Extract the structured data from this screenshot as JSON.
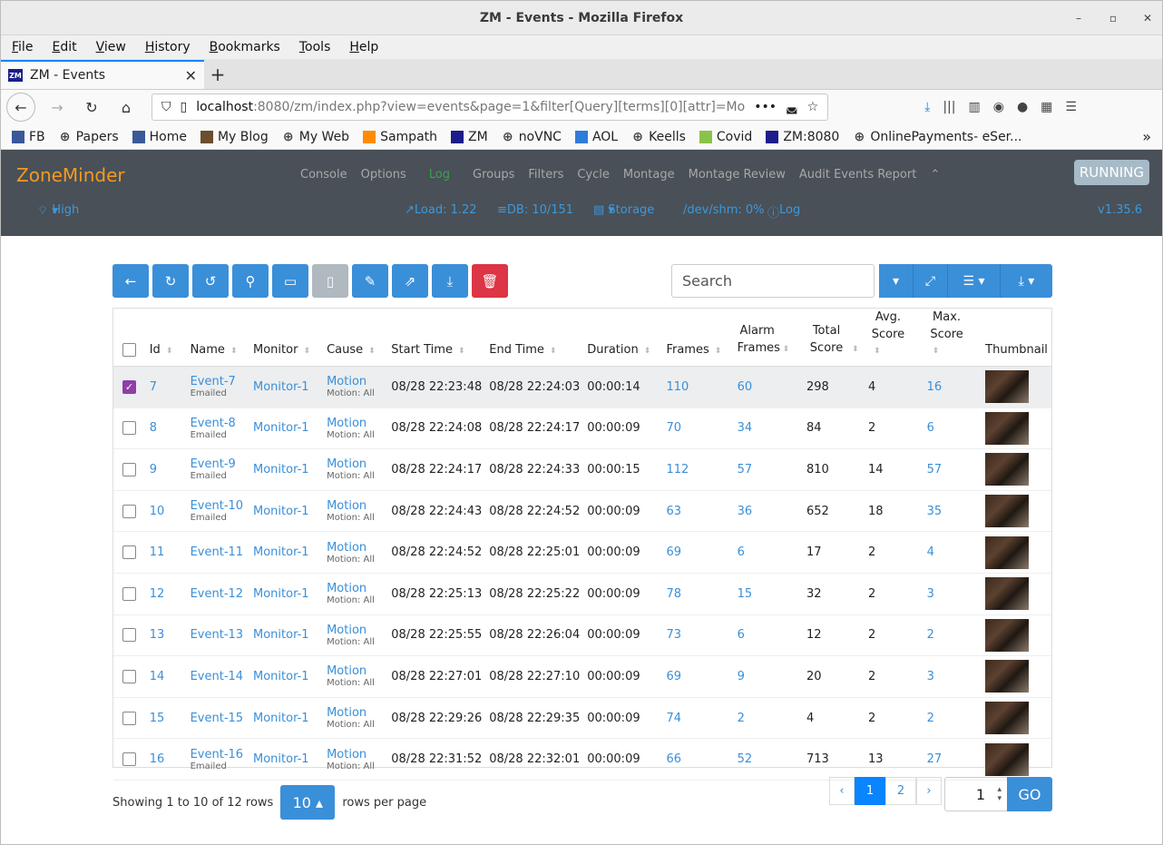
{
  "window": {
    "title": "ZM - Events - Mozilla Firefox"
  },
  "menu": [
    "File",
    "Edit",
    "View",
    "History",
    "Bookmarks",
    "Tools",
    "Help"
  ],
  "tab": {
    "title": "ZM - Events"
  },
  "url": {
    "host": "localhost",
    "rest": ":8080/zm/index.php?view=events&page=1&filter[Query][terms][0][attr]=Mo"
  },
  "bookmarks": [
    "FB",
    "Papers",
    "Home",
    "My Blog",
    "My Web",
    "Sampath",
    "ZM",
    "noVNC",
    "AOL",
    "Keells",
    "Covid",
    "ZM:8080",
    "OnlinePayments- eSer..."
  ],
  "zm": {
    "brand": "ZoneMinder",
    "nav": [
      "Console",
      "Options",
      "Log",
      "Groups",
      "Filters",
      "Cycle",
      "Montage",
      "Montage Review",
      "Audit Events Report"
    ],
    "running": "RUNNING",
    "bandwidth": "High",
    "load": "Load: 1.22",
    "db": "DB: 10/151",
    "storage": "Storage",
    "shm": "/dev/shm: 0%",
    "log": "Log",
    "version": "v1.35.6"
  },
  "search": {
    "placeholder": "Search"
  },
  "columns": [
    "Id",
    "Name",
    "Monitor",
    "Cause",
    "Start Time",
    "End Time",
    "Duration",
    "Frames",
    "Alarm Frames",
    "Total Score",
    "Avg. Score",
    "Max. Score",
    "Thumbnail"
  ],
  "rows": [
    {
      "id": "7",
      "name": "Event-7",
      "note": "Emailed",
      "monitor": "Monitor-1",
      "cause": "Motion",
      "causeSub": "Motion: All",
      "start": "08/28 22:23:48",
      "end": "08/28 22:24:03",
      "dur": "00:00:14",
      "frames": "110",
      "alarm": "60",
      "total": "298",
      "avg": "4",
      "max": "16",
      "checked": true
    },
    {
      "id": "8",
      "name": "Event-8",
      "note": "Emailed",
      "monitor": "Monitor-1",
      "cause": "Motion",
      "causeSub": "Motion: All",
      "start": "08/28 22:24:08",
      "end": "08/28 22:24:17",
      "dur": "00:00:09",
      "frames": "70",
      "alarm": "34",
      "total": "84",
      "avg": "2",
      "max": "6",
      "checked": false
    },
    {
      "id": "9",
      "name": "Event-9",
      "note": "Emailed",
      "monitor": "Monitor-1",
      "cause": "Motion",
      "causeSub": "Motion: All",
      "start": "08/28 22:24:17",
      "end": "08/28 22:24:33",
      "dur": "00:00:15",
      "frames": "112",
      "alarm": "57",
      "total": "810",
      "avg": "14",
      "max": "57",
      "checked": false
    },
    {
      "id": "10",
      "name": "Event-10",
      "note": "Emailed",
      "monitor": "Monitor-1",
      "cause": "Motion",
      "causeSub": "Motion: All",
      "start": "08/28 22:24:43",
      "end": "08/28 22:24:52",
      "dur": "00:00:09",
      "frames": "63",
      "alarm": "36",
      "total": "652",
      "avg": "18",
      "max": "35",
      "checked": false
    },
    {
      "id": "11",
      "name": "Event-11",
      "note": "",
      "monitor": "Monitor-1",
      "cause": "Motion",
      "causeSub": "Motion: All",
      "start": "08/28 22:24:52",
      "end": "08/28 22:25:01",
      "dur": "00:00:09",
      "frames": "69",
      "alarm": "6",
      "total": "17",
      "avg": "2",
      "max": "4",
      "checked": false
    },
    {
      "id": "12",
      "name": "Event-12",
      "note": "",
      "monitor": "Monitor-1",
      "cause": "Motion",
      "causeSub": "Motion: All",
      "start": "08/28 22:25:13",
      "end": "08/28 22:25:22",
      "dur": "00:00:09",
      "frames": "78",
      "alarm": "15",
      "total": "32",
      "avg": "2",
      "max": "3",
      "checked": false
    },
    {
      "id": "13",
      "name": "Event-13",
      "note": "",
      "monitor": "Monitor-1",
      "cause": "Motion",
      "causeSub": "Motion: All",
      "start": "08/28 22:25:55",
      "end": "08/28 22:26:04",
      "dur": "00:00:09",
      "frames": "73",
      "alarm": "6",
      "total": "12",
      "avg": "2",
      "max": "2",
      "checked": false
    },
    {
      "id": "14",
      "name": "Event-14",
      "note": "",
      "monitor": "Monitor-1",
      "cause": "Motion",
      "causeSub": "Motion: All",
      "start": "08/28 22:27:01",
      "end": "08/28 22:27:10",
      "dur": "00:00:09",
      "frames": "69",
      "alarm": "9",
      "total": "20",
      "avg": "2",
      "max": "3",
      "checked": false
    },
    {
      "id": "15",
      "name": "Event-15",
      "note": "",
      "monitor": "Monitor-1",
      "cause": "Motion",
      "causeSub": "Motion: All",
      "start": "08/28 22:29:26",
      "end": "08/28 22:29:35",
      "dur": "00:00:09",
      "frames": "74",
      "alarm": "2",
      "total": "4",
      "avg": "2",
      "max": "2",
      "checked": false
    },
    {
      "id": "16",
      "name": "Event-16",
      "note": "Emailed",
      "monitor": "Monitor-1",
      "cause": "Motion",
      "causeSub": "Motion: All",
      "start": "08/28 22:31:52",
      "end": "08/28 22:32:01",
      "dur": "00:00:09",
      "frames": "66",
      "alarm": "52",
      "total": "713",
      "avg": "13",
      "max": "27",
      "checked": false
    }
  ],
  "footer": {
    "showing": "Showing 1 to 10 of 12 rows",
    "perPage": "10",
    "perPageLabel": "rows per page",
    "pages": [
      "‹",
      "1",
      "2",
      "›"
    ],
    "goto": "1",
    "go": "GO"
  }
}
